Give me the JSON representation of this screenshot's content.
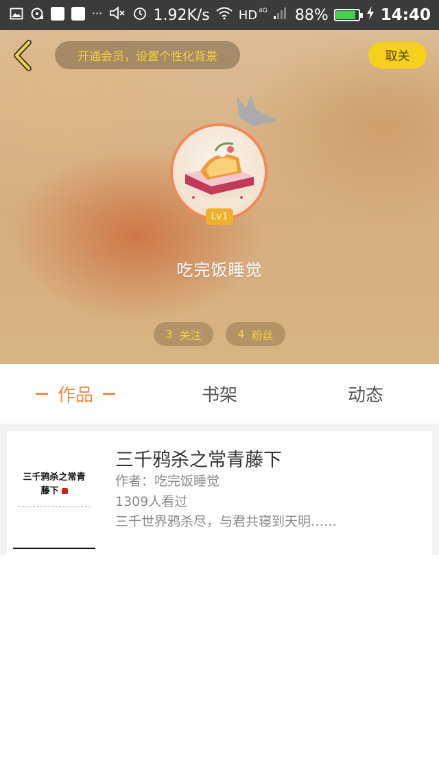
{
  "status_bar": {
    "speed": "1.92K/s",
    "network": "HD",
    "network_gen": "4G",
    "battery": "88%",
    "battery_level": 0.88,
    "time": "14:40",
    "more": "···"
  },
  "header": {
    "vip_prompt": "开通会员，设置个性化背景",
    "cancel_label": "取关",
    "level": "Lv1",
    "username": "吃完饭睡觉",
    "stats": {
      "follow_count": "3",
      "follow_label": "关注",
      "fans_count": "4",
      "fans_label": "粉丝"
    }
  },
  "tabs": [
    {
      "label": "作品",
      "active": true
    },
    {
      "label": "书架",
      "active": false
    },
    {
      "label": "动态",
      "active": false
    }
  ],
  "works": [
    {
      "cover_line1": "三千鸦杀之常青",
      "cover_line2": "藤下",
      "title": "三千鸦杀之常青藤下",
      "author": "作者：吃完饭睡觉",
      "views": "1309人看过",
      "description": "三千世界鸦杀尽，与君共寝到天明……"
    }
  ],
  "colors": {
    "accent": "#ee8a45",
    "vip_text": "#f4d23c",
    "cancel_bg": "#f5d11d",
    "status_bar": "#3b3b3b"
  }
}
